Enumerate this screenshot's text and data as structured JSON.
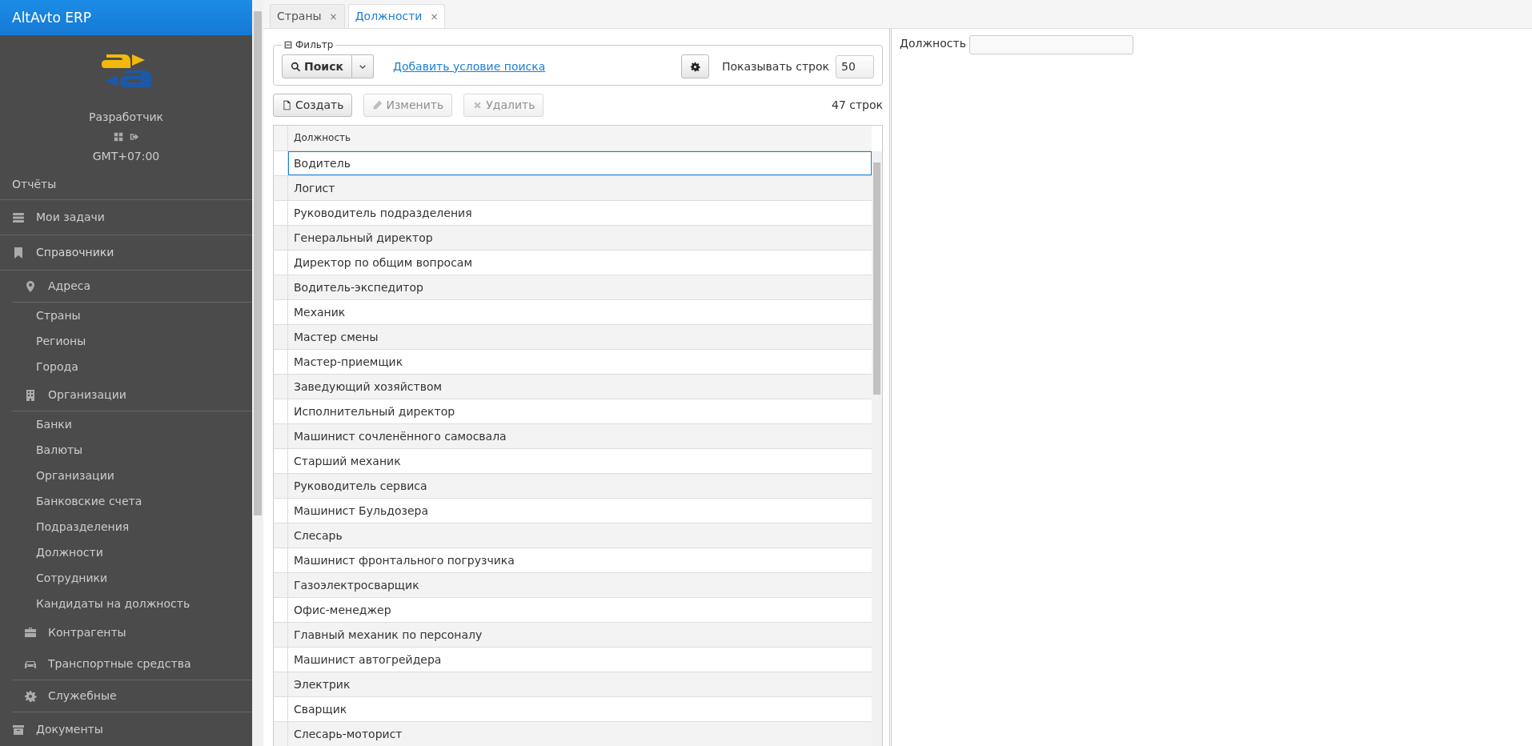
{
  "app": {
    "title": "AltAvto ERP",
    "user": "Разработчик",
    "timezone": "GMT+07:00"
  },
  "sidebar": {
    "items": [
      {
        "label": "Отчёты",
        "kind": "plain"
      },
      {
        "label": "Мои задачи",
        "kind": "tasks"
      },
      {
        "label": "Справочники",
        "kind": "bookmark",
        "expanded": true,
        "children": [
          {
            "label": "Адреса",
            "kind": "pin",
            "expanded": true,
            "children": [
              {
                "label": "Страны"
              },
              {
                "label": "Регионы"
              },
              {
                "label": "Города"
              }
            ]
          },
          {
            "label": "Организации",
            "kind": "building",
            "expanded": true,
            "children": [
              {
                "label": "Банки"
              },
              {
                "label": "Валюты"
              },
              {
                "label": "Организации"
              },
              {
                "label": "Банковские счета"
              },
              {
                "label": "Подразделения"
              },
              {
                "label": "Должности"
              },
              {
                "label": "Сотрудники"
              },
              {
                "label": "Кандидаты на должность"
              }
            ]
          },
          {
            "label": "Контрагенты",
            "kind": "briefcase",
            "expanded": false
          },
          {
            "label": "Транспортные средства",
            "kind": "car",
            "expanded": false
          },
          {
            "label": "Служебные",
            "kind": "gear",
            "expanded": false
          }
        ]
      },
      {
        "label": "Документы",
        "kind": "archive"
      }
    ]
  },
  "tabs": [
    {
      "label": "Страны",
      "selected": false,
      "close": "×"
    },
    {
      "label": "Должности",
      "selected": true,
      "close": "×"
    }
  ],
  "filter": {
    "legend": "Фильтр",
    "search_button": "Поиск",
    "add_condition": "Добавить условие поиска",
    "rows_label": "Показывать строк",
    "rows_value": "50"
  },
  "toolbar": [
    {
      "label": "Создать",
      "kind": "file",
      "disabled": false
    },
    {
      "label": "Изменить",
      "kind": "pencil",
      "disabled": true
    },
    {
      "label": "Удалить",
      "kind": "cross",
      "disabled": true
    }
  ],
  "row_count": "47 строк",
  "table": {
    "columns": [
      "Должность"
    ],
    "rows": [
      {
        "cell": "Водитель",
        "selected": true
      },
      {
        "cell": "Логист",
        "selected": false
      },
      {
        "cell": "Руководитель подразделения",
        "selected": false
      },
      {
        "cell": "Генеральный директор",
        "selected": false
      },
      {
        "cell": "Директор по общим вопросам",
        "selected": false
      },
      {
        "cell": "Водитель-экспедитор",
        "selected": false
      },
      {
        "cell": "Механик",
        "selected": false
      },
      {
        "cell": "Мастер смены",
        "selected": false
      },
      {
        "cell": "Мастер-приемщик",
        "selected": false
      },
      {
        "cell": "Заведующий хозяйством",
        "selected": false
      },
      {
        "cell": "Исполнительный директор",
        "selected": false
      },
      {
        "cell": "Машинист сочленённого самосвала",
        "selected": false
      },
      {
        "cell": "Старший механик",
        "selected": false
      },
      {
        "cell": "Руководитель сервиса",
        "selected": false
      },
      {
        "cell": "Машинист Бульдозера",
        "selected": false
      },
      {
        "cell": "Слесарь",
        "selected": false
      },
      {
        "cell": "Машинист фронтального погрузчика",
        "selected": false
      },
      {
        "cell": "Газоэлектросварщик",
        "selected": false
      },
      {
        "cell": "Офис-менеджер",
        "selected": false
      },
      {
        "cell": "Главный механик по персоналу",
        "selected": false
      },
      {
        "cell": "Машинист автогрейдера",
        "selected": false
      },
      {
        "cell": "Электрик",
        "selected": false
      },
      {
        "cell": "Сварщик",
        "selected": false
      },
      {
        "cell": "Слесарь-моторист",
        "selected": false
      }
    ]
  },
  "detail": {
    "label": "Должность"
  }
}
